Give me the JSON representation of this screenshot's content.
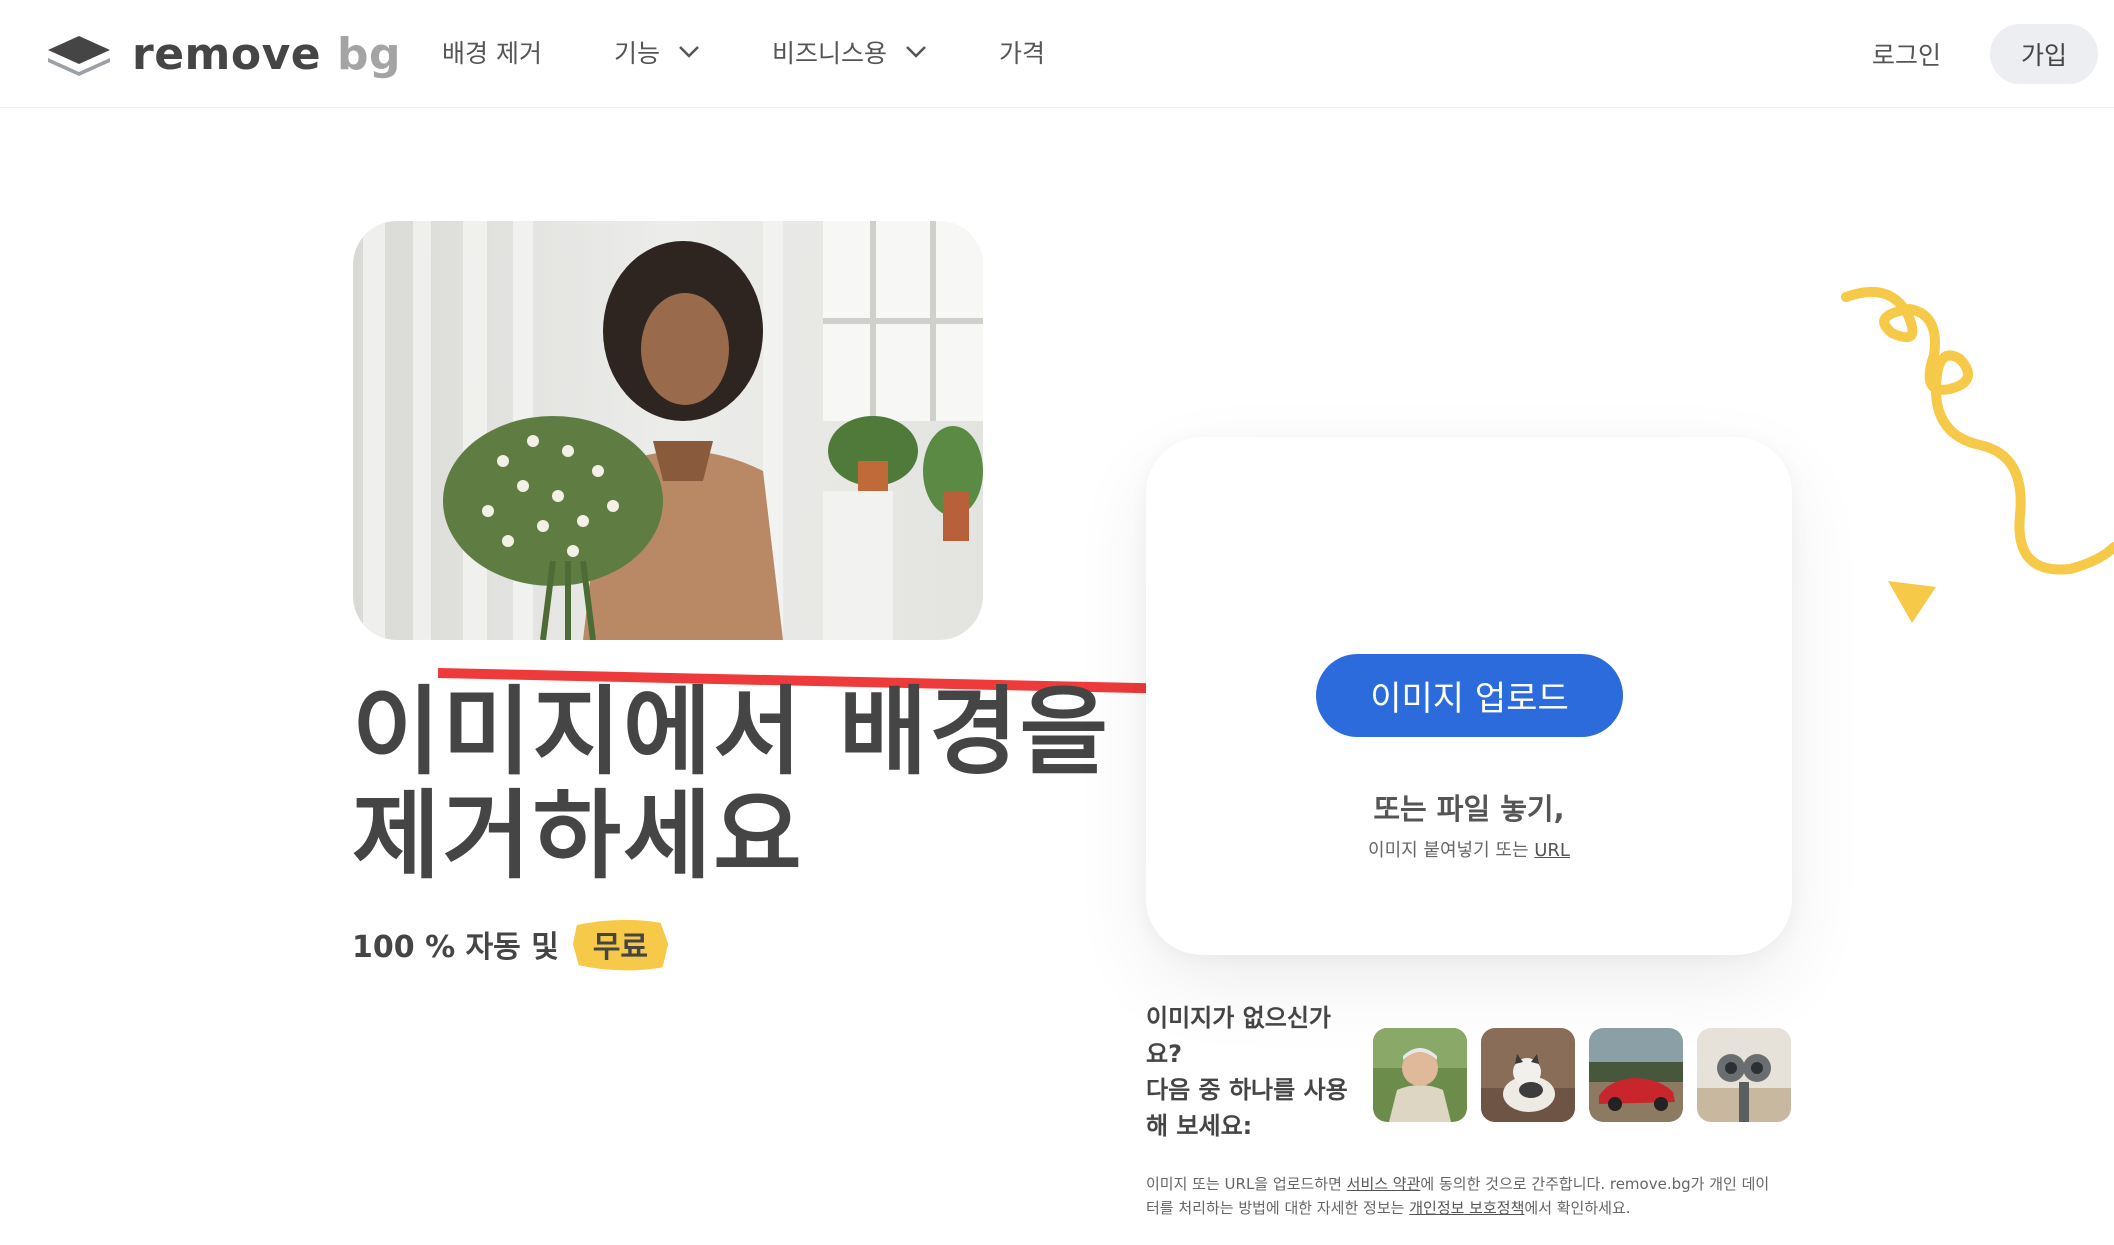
{
  "header": {
    "logo_text_main": "remove",
    "logo_text_accent": "bg",
    "nav": [
      {
        "label": "배경 제거",
        "has_dropdown": false
      },
      {
        "label": "기능",
        "has_dropdown": true
      },
      {
        "label": "비즈니스용",
        "has_dropdown": true
      },
      {
        "label": "가격",
        "has_dropdown": false
      }
    ],
    "login_label": "로그인",
    "signup_label": "가입"
  },
  "hero": {
    "title_line1": "이미지에서 배경을",
    "title_line2": "제거하세요",
    "subtitle": "100 % 자동 및",
    "free_badge": "무료"
  },
  "upload": {
    "button_label": "이미지 업로드",
    "or_drop": "또는 파일 놓기,",
    "paste_prefix": "이미지 붙여넣기 또는 ",
    "paste_link": "URL"
  },
  "samples": {
    "prompt_line1": "이미지가 없으신가",
    "prompt_line2": "요?",
    "prompt_line3": "다음 중 하나를 사용",
    "prompt_line4": "해 보세요:",
    "items": [
      "person-sample",
      "cat-sample",
      "car-sample",
      "binoculars-sample"
    ]
  },
  "terms": {
    "part1": "이미지 또는 URL을 업로드하면 ",
    "link1": "서비스 약관",
    "part2": "에 동의한 것으로 간주합니다. remove.bg가 개인 데이",
    "part3": "터를 처리하는 방법에 대한 자세한 정보는 ",
    "link2": "개인정보 보호정책",
    "part4": "에서 확인하세요."
  },
  "colors": {
    "primary": "#2b6bdc",
    "accent_yellow": "#f7c948",
    "text": "#454545",
    "annotation_arrow": "#ee3a3a"
  }
}
